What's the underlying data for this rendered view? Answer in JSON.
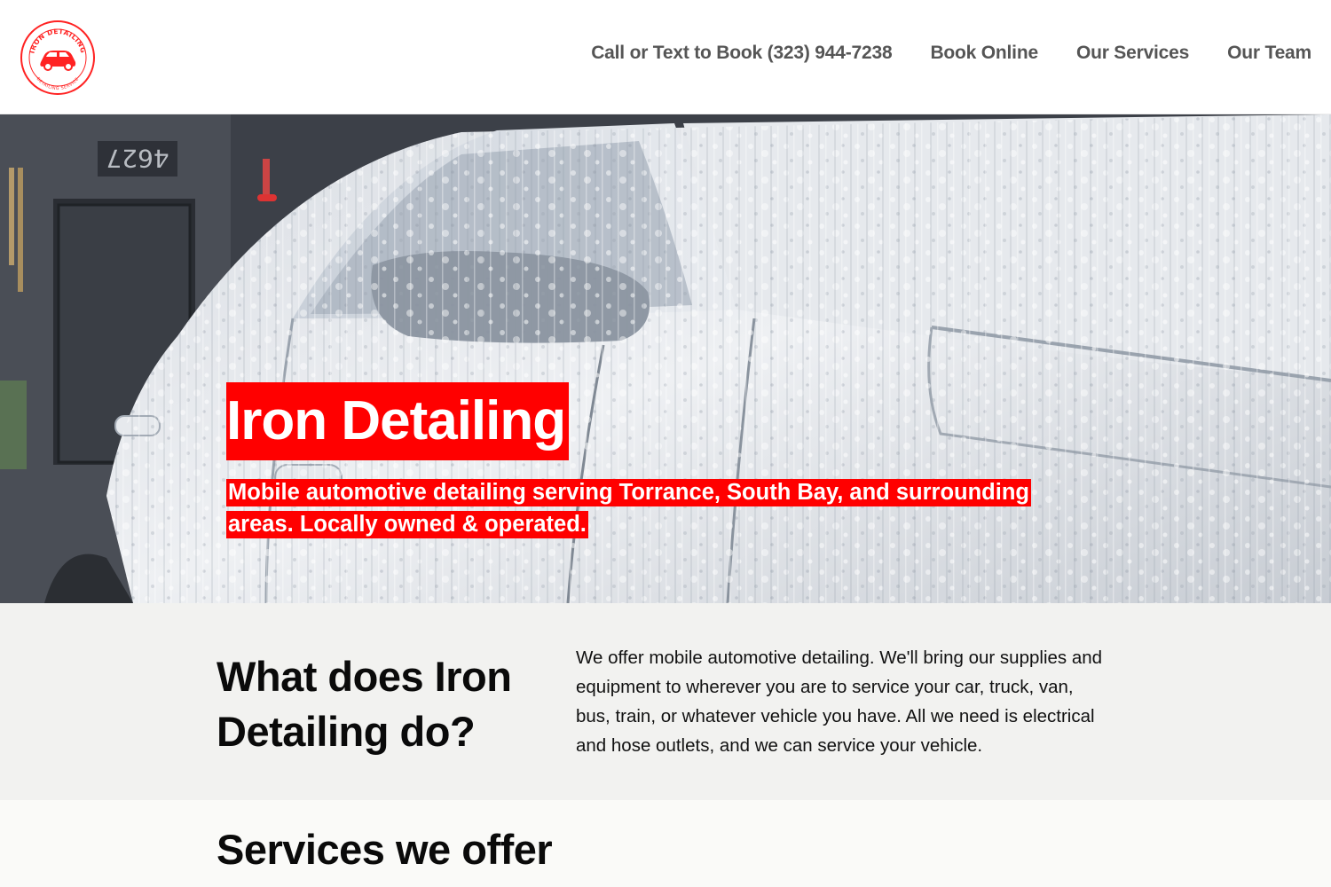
{
  "brand": {
    "logo_icon": "red-car-badge-logo",
    "logo_text_top": "IRON DETAILING",
    "logo_text_bottom": "DETAILING SERVICE",
    "accent_color": "#ff0000"
  },
  "nav": {
    "items": [
      {
        "label": "Call or Text to Book (323) 944-7238"
      },
      {
        "label": "Book Online"
      },
      {
        "label": "Our Services"
      },
      {
        "label": "Our Team"
      }
    ]
  },
  "hero": {
    "title": "Iron Detailing",
    "subtitle": "Mobile automotive detailing serving Torrance, South Bay, and surrounding areas. Locally owned & operated.",
    "house_number": "4627"
  },
  "about": {
    "heading": "What does Iron Detailing do?",
    "body": "We offer mobile automotive detailing. We'll bring our supplies and equipment to wherever you are to service your car, truck, van, bus, train, or whatever vehicle you have. All we need is electrical and hose outlets, and we can service your vehicle."
  },
  "services": {
    "heading": "Services we offer"
  }
}
